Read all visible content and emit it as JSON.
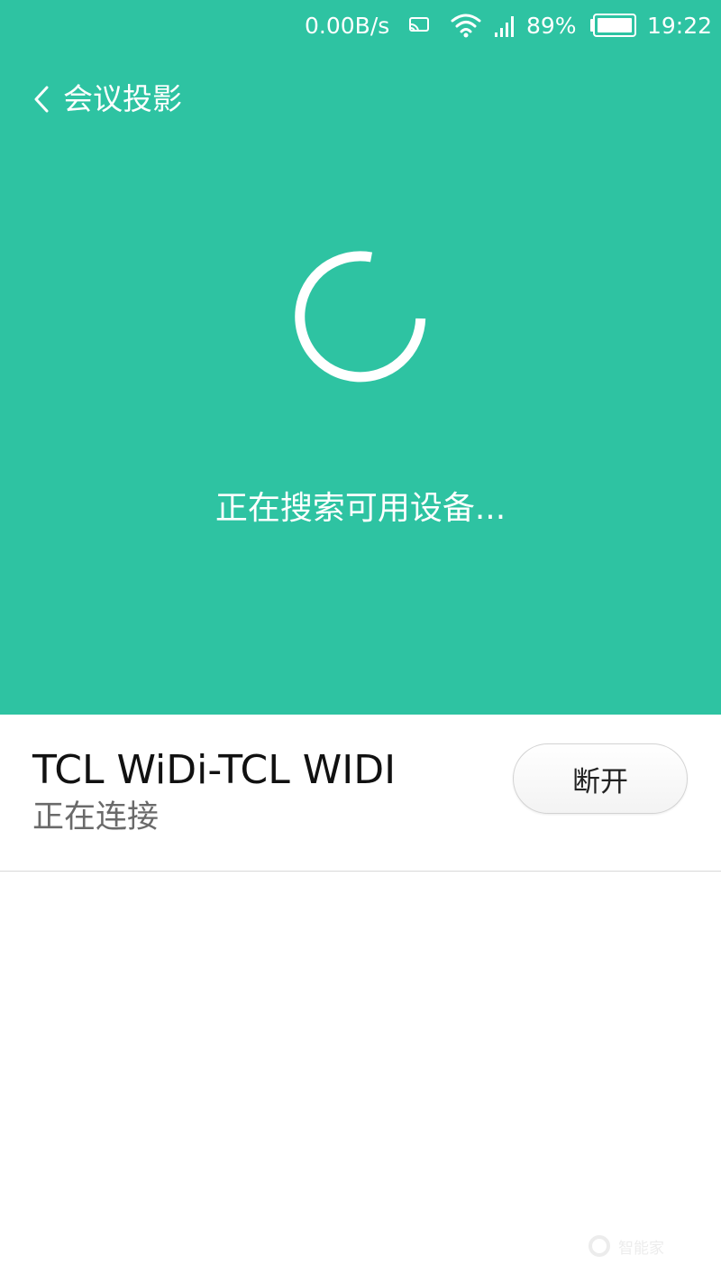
{
  "status_bar": {
    "net_speed": "0.00B/s",
    "battery_percent": "89%",
    "time": "19:22",
    "icons": [
      "cast-icon",
      "wifi-icon",
      "signal-icon",
      "battery-icon"
    ]
  },
  "header": {
    "title": "会议投影",
    "back_icon": "chevron-left-icon"
  },
  "hero": {
    "background_color": "#2ec3a2",
    "spinner_icon": "loading-spinner-icon",
    "searching_text": "正在搜索可用设备..."
  },
  "device": {
    "name": "TCL WiDi-TCL WIDI",
    "status": "正在连接",
    "disconnect_label": "断开"
  },
  "watermark": {
    "logo_icon": "watermark-logo-icon",
    "text": "智能家"
  }
}
